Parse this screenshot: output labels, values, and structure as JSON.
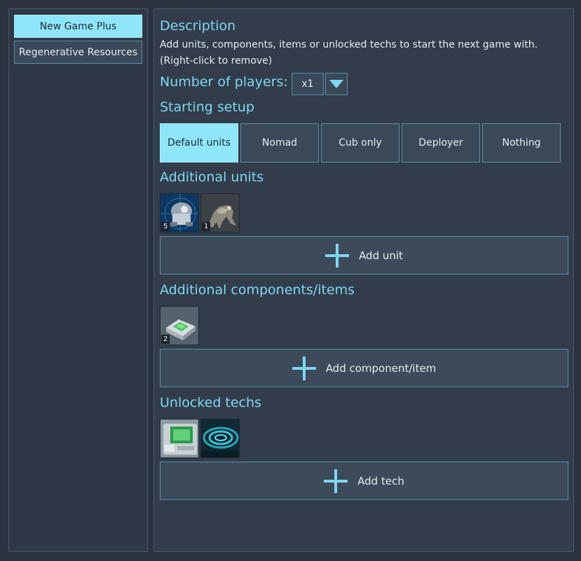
{
  "sidebar": {
    "items": [
      {
        "label": "New Game Plus",
        "active": true
      },
      {
        "label": "Regenerative Resources",
        "active": false
      }
    ]
  },
  "description": {
    "heading": "Description",
    "line1": "Add units, components, items or unlocked techs to start the next game with.",
    "line2": "(Right-click to remove)"
  },
  "players": {
    "label": "Number of players:",
    "value": "x1"
  },
  "setup": {
    "heading": "Starting setup",
    "options": [
      "Default units",
      "Nomad",
      "Cub only",
      "Deployer",
      "Nothing"
    ],
    "selected": "Default units"
  },
  "units": {
    "heading": "Additional units",
    "items": [
      {
        "icon": "bot-unit-icon",
        "count": "5"
      },
      {
        "icon": "alien-unit-icon",
        "count": "1"
      }
    ],
    "add_label": "Add unit"
  },
  "components": {
    "heading": "Additional components/items",
    "items": [
      {
        "icon": "chip-component-icon",
        "count": "2"
      }
    ],
    "add_label": "Add component/item"
  },
  "techs": {
    "heading": "Unlocked techs",
    "items": [
      {
        "icon": "computer-tech-icon"
      },
      {
        "icon": "rings-tech-icon"
      }
    ],
    "add_label": "Add tech"
  },
  "colors": {
    "accent": "#7ed8f4",
    "active_bg": "#8fe6fb",
    "panel": "#323c4a"
  }
}
